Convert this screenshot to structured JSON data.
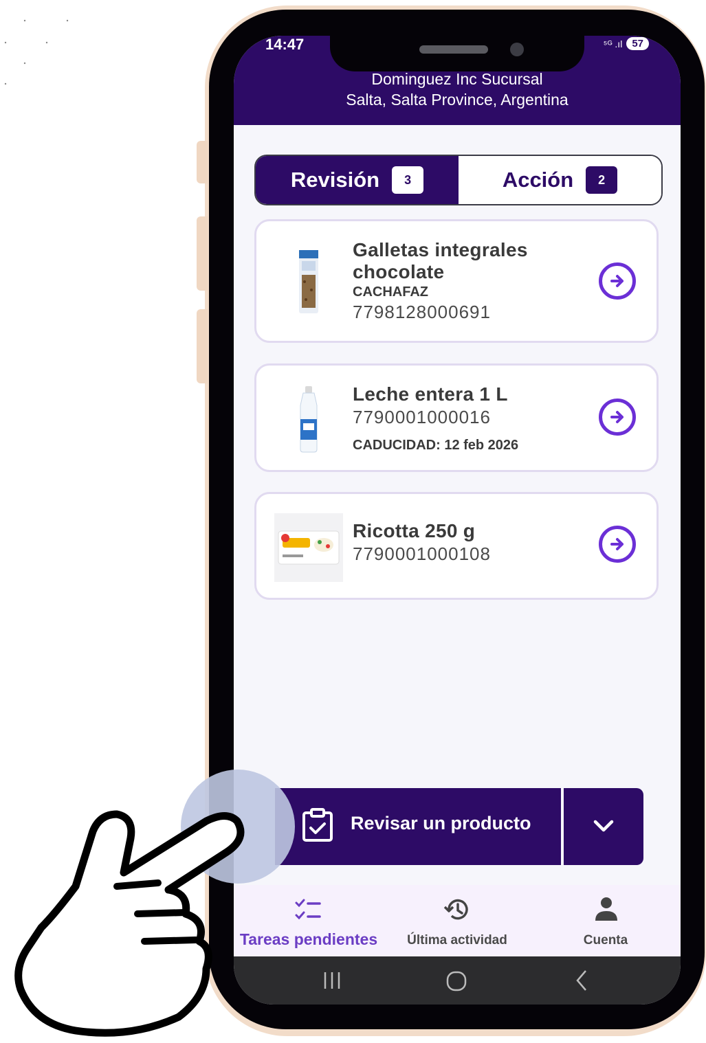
{
  "status_bar": {
    "time": "14:47",
    "signal": "⁵ᴳ .ıl",
    "battery": "57"
  },
  "header": {
    "store_name": "Dominguez Inc Sucursal",
    "store_location": "Salta, Salta Province, Argentina"
  },
  "tabs": [
    {
      "label": "Revisión",
      "count": "3",
      "active": true
    },
    {
      "label": "Acción",
      "count": "2",
      "active": false
    }
  ],
  "products": [
    {
      "name_line1": "Galletas integrales",
      "name_line2": "chocolate",
      "brand": "CACHAFAZ",
      "code": "7798128000691"
    },
    {
      "name_line1": "Leche entera 1 L",
      "code": "7790001000016",
      "expiry": "CADUCIDAD: 12 feb 2026"
    },
    {
      "name_line1": "Ricotta 250 g",
      "code": "7790001000108"
    }
  ],
  "action": {
    "label": "Revisar un producto"
  },
  "bottom_nav": [
    {
      "label": "Tareas pendientes",
      "icon": "checklist-icon",
      "active": true
    },
    {
      "label": "Última actividad",
      "icon": "history-icon",
      "active": false
    },
    {
      "label": "Cuenta",
      "icon": "person-icon",
      "active": false
    }
  ],
  "colors": {
    "primary": "#2d0b66",
    "accent": "#6b2fd6",
    "frame": "#f2dcc9"
  }
}
